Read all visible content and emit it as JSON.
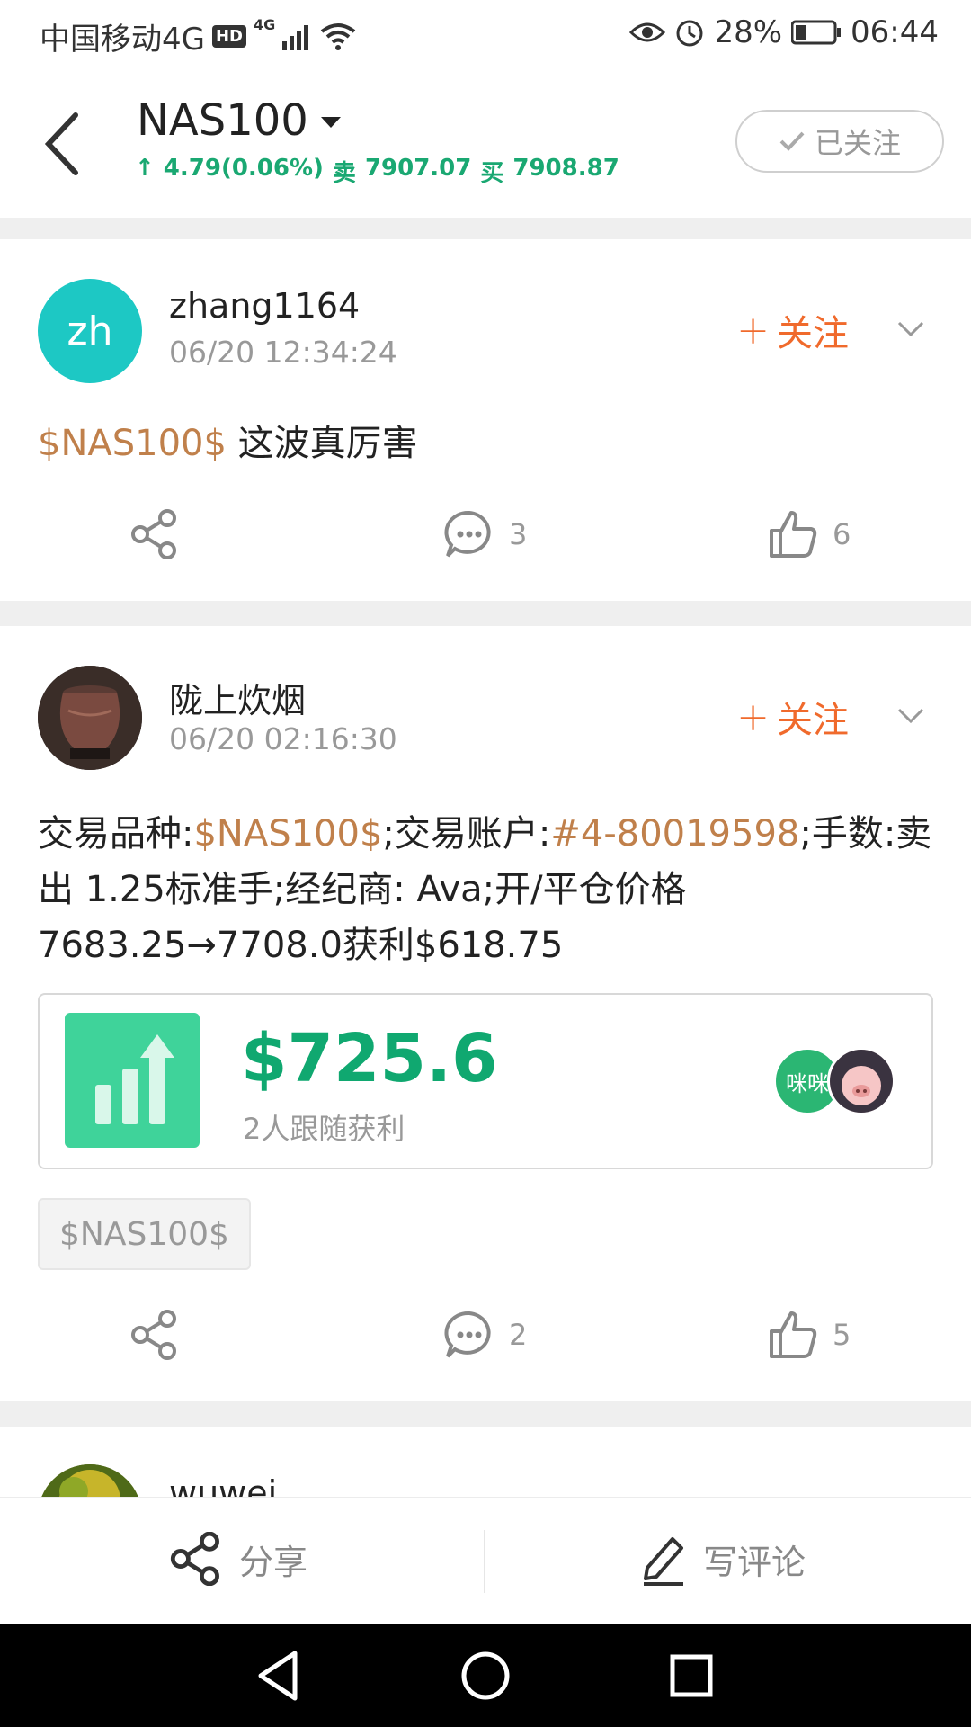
{
  "status": {
    "carrier": "中国移动4G",
    "hd": "HD",
    "net": "4G",
    "battery": "28%",
    "time": "06:44"
  },
  "header": {
    "title": "NAS100",
    "quote": {
      "change": "4.79(0.06%)",
      "sell_label": "卖",
      "sell": "7907.07",
      "buy_label": "买",
      "buy": "7908.87"
    },
    "followed_label": "已关注"
  },
  "posts": [
    {
      "user": "zhang1164",
      "avatar_text": "zh",
      "time": "06/20 12:34:24",
      "follow_label": "关注",
      "text_tag": "$NAS100$",
      "text": " 这波真厉害",
      "comments": "3",
      "likes": "6"
    },
    {
      "user": "陇上炊烟",
      "time": "06/20 02:16:30",
      "follow_label": "关注",
      "text_parts": {
        "p1": "交易品种:",
        "tag1": "$NAS100$",
        "p2": ";交易账户:",
        "tag2": "#4-80019598",
        "p3": ";手数:卖出 1.25标准手;经纪商: Ava;开/平仓价格7683.25→7708.0获利$618.75"
      },
      "profit_value": "$725.6",
      "profit_sub": "2人跟随获利",
      "follower1_text": "咪咪",
      "chip": "$NAS100$",
      "comments": "2",
      "likes": "5"
    },
    {
      "user": "wuwei"
    }
  ],
  "bottom_bar": {
    "share_label": "分享",
    "comment_label": "写评论"
  },
  "colors": {
    "accent_orange": "#f06a2c",
    "tag_brown": "#c0804b",
    "up_green": "#1aa872",
    "profit_green": "#10a870"
  }
}
